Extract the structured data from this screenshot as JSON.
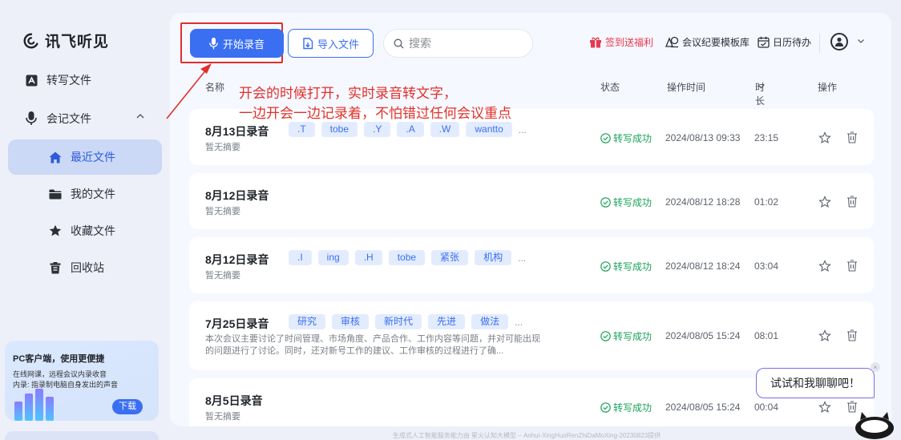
{
  "app": {
    "logo_text": "讯飞听见"
  },
  "sidebar": {
    "items": [
      {
        "label": "转写文件",
        "icon": "transcribe-file-icon"
      },
      {
        "label": "会记文件",
        "icon": "microphone-icon"
      },
      {
        "label": "最近文件",
        "icon": "home-icon",
        "active": true
      },
      {
        "label": "我的文件",
        "icon": "folder-icon"
      },
      {
        "label": "收藏文件",
        "icon": "star-icon"
      },
      {
        "label": "回收站",
        "icon": "trash-icon"
      }
    ],
    "promo": {
      "title": "PC客户端，使用更便捷",
      "line1": "在线网课，远程会议内录收音",
      "line2": "内录: 指录制电脑自身发出的声音",
      "button": "下载"
    }
  },
  "toolbar": {
    "record_label": "开始录音",
    "import_label": "导入文件",
    "search_placeholder": "搜索",
    "gift_label": "签到送福利",
    "template_label": "会议纪要模板库",
    "calendar_label": "日历待办"
  },
  "list_header": {
    "name": "名称",
    "status": "状态",
    "time": "操作时间",
    "duration": "时长",
    "actions": "操作"
  },
  "annotation": {
    "line1": "开会的时候打开，实时录音转文字，",
    "line2": "一边开会一边记录着，不怕错过任何会议重点"
  },
  "files": [
    {
      "title": "8月13日录音",
      "tags": [
        ".T",
        "tobe",
        ".Y",
        ".A",
        ".W",
        "wantto"
      ],
      "summary": "暂无摘要",
      "status": "转写成功",
      "time": "2024/08/13 09:33",
      "duration": "23:15"
    },
    {
      "title": "8月12日录音",
      "tags": [],
      "summary": "暂无摘要",
      "status": "转写成功",
      "time": "2024/08/12 18:28",
      "duration": "01:02"
    },
    {
      "title": "8月12日录音",
      "tags": [
        ".I",
        "ing",
        ".H",
        "tobe",
        "紧张",
        "机构"
      ],
      "summary": "暂无摘要",
      "status": "转写成功",
      "time": "2024/08/12 18:24",
      "duration": "03:04"
    },
    {
      "title": "7月25日录音",
      "tags": [
        "研究",
        "审核",
        "新时代",
        "先进",
        "做法"
      ],
      "summary": "本次会议主要讨论了时间管理、市场角度、产品合作、工作内容等问题，并对可能出现的问题进行了讨论。同时，还对新号工作的建议、工作审核的过程进行了确...",
      "status": "转写成功",
      "time": "2024/08/05 15:24",
      "duration": "08:01"
    },
    {
      "title": "8月5日录音",
      "tags": [],
      "summary": "暂无摘要",
      "status": "转写成功",
      "time": "2024/08/05 15:24",
      "duration": "00:04"
    }
  ],
  "tag_more": "...",
  "footer": "生成式人工智能服务能力由 星火认知大模型 – Anhui-XingHuoRenZhiDaMoXing-20230823提供",
  "chat": {
    "bubble": "试试和我聊聊吧！",
    "close": "×"
  },
  "colors": {
    "accent": "#3a6ff2",
    "success": "#1aa35a",
    "annotation": "#e0302b",
    "gift": "#e8384f"
  }
}
